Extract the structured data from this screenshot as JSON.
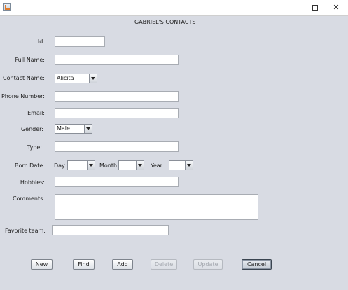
{
  "window": {
    "icon": "java-app-icon",
    "minimize_glyph": "—",
    "maximize_glyph": "□",
    "close_glyph": "✕"
  },
  "form": {
    "title": "GABRIEL'S CONTACTS",
    "labels": {
      "id": "Id:",
      "full_name": "Full Name:",
      "contact_name": "Contact Name:",
      "phone_number": "Phone Number:",
      "email": "Email:",
      "gender": "Gender:",
      "type": "Type:",
      "born_date": "Born Date:",
      "hobbies": "Hobbies:",
      "comments": "Comments:",
      "favorite_team": "Favorite team:"
    },
    "values": {
      "id": "",
      "full_name": "",
      "contact_name": "Alicita",
      "phone_number": "",
      "email": "",
      "gender": "Male",
      "type": "",
      "day": "",
      "month": "",
      "year": "",
      "hobbies": "",
      "comments": "",
      "favorite_team": ""
    },
    "date_labels": {
      "day": "Day",
      "month": "Month",
      "year": "Year"
    }
  },
  "buttons": {
    "new": "New",
    "find": "Find",
    "add": "Add",
    "delete": "Delete",
    "update": "Update",
    "cancel": "Cancel"
  }
}
